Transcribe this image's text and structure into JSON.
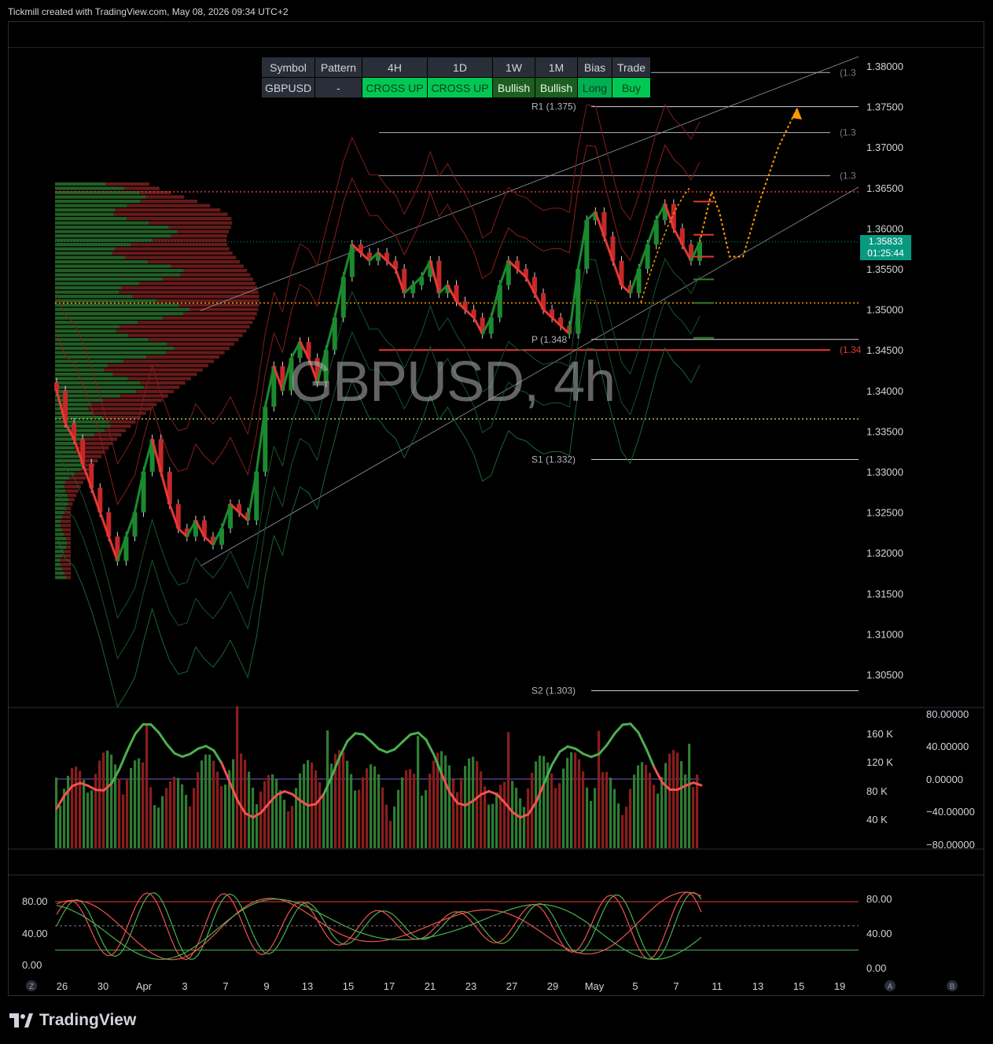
{
  "header": {
    "text": "Tickmill created with TradingView.com, May 08, 2026 09:34 UTC+2"
  },
  "brand": {
    "name": "TradingView"
  },
  "watermark": {
    "symbol": "GBPUSD, 4h"
  },
  "table": {
    "headers": [
      "Symbol",
      "Pattern",
      "4H",
      "1D",
      "1W",
      "1M",
      "Bias",
      "Trade"
    ],
    "row": [
      "GBPUSD",
      "-",
      "CROSS UP",
      "CROSS UP",
      "Bullish",
      "Bullish",
      "Long",
      "Buy"
    ]
  },
  "price_tag": {
    "price": "1.35833",
    "countdown": "01:25:44"
  },
  "colors": {
    "up": "#2e7d32",
    "down": "#e53935",
    "accent_orange": "#ff9800",
    "price_tag": "#089981"
  },
  "chart_data": [
    {
      "type": "line",
      "name": "price",
      "ylabel": "",
      "y_ticks": [
        "1.38000",
        "1.37500",
        "1.37000",
        "1.36500",
        "1.36000",
        "1.35500",
        "1.35000",
        "1.34500",
        "1.34000",
        "1.33500",
        "1.33000",
        "1.32500",
        "1.32000",
        "1.31500",
        "1.31000",
        "1.30500"
      ],
      "ylim": [
        1.3015,
        1.3825
      ],
      "x_ticks": [
        "26",
        "30",
        "Apr",
        "3",
        "7",
        "9",
        "13",
        "15",
        "17",
        "21",
        "23",
        "27",
        "29",
        "May",
        "5",
        "7",
        "11",
        "13",
        "15",
        "19"
      ],
      "levels": [
        {
          "label": "R1 (1.375)",
          "value": 1.375
        },
        {
          "label": "P (1.348",
          "value": 1.3463
        },
        {
          "label": "S1 (1.332)",
          "value": 1.3315
        },
        {
          "label": "S2 (1.303)",
          "value": 1.303
        },
        {
          "label": "(1.3",
          "value": 1.3792
        },
        {
          "label": "(1.3",
          "value": 1.3718
        },
        {
          "label": "(1.3",
          "value": 1.3665
        },
        {
          "label": "(1.34",
          "value": 1.345
        }
      ],
      "horizontal_refs": [
        1.3645,
        1.3508,
        1.3365
      ],
      "close_path": [
        1.34,
        1.336,
        1.334,
        1.331,
        1.328,
        1.325,
        1.322,
        1.319,
        1.322,
        1.325,
        1.33,
        1.334,
        1.33,
        1.326,
        1.323,
        1.322,
        1.324,
        1.322,
        1.321,
        1.323,
        1.326,
        1.325,
        1.324,
        1.33,
        1.338,
        1.343,
        1.34,
        1.344,
        1.346,
        1.344,
        1.341,
        1.345,
        1.349,
        1.354,
        1.358,
        1.357,
        1.356,
        1.357,
        1.356,
        1.355,
        1.352,
        1.353,
        1.354,
        1.356,
        1.352,
        1.353,
        1.351,
        1.35,
        1.349,
        1.347,
        1.349,
        1.353,
        1.356,
        1.355,
        1.354,
        1.352,
        1.35,
        1.349,
        1.348,
        1.347,
        1.355,
        1.361,
        1.362,
        1.359,
        1.356,
        1.353,
        1.352,
        1.355,
        1.358,
        1.361,
        1.363,
        1.36,
        1.358,
        1.356,
        1.3583
      ],
      "projection": [
        1.3583,
        1.3645,
        1.362,
        1.3565,
        1.3565,
        1.363,
        1.37,
        1.375
      ],
      "last_price": 1.35833
    },
    {
      "type": "bar",
      "name": "volume",
      "y_ticks_left": [
        "160 K",
        "120 K",
        "80 K",
        "40 K"
      ],
      "y_ticks_right": [
        "80.00000",
        "40.00000",
        "0.00000",
        "−40.00000",
        "−80.00000"
      ],
      "ylim": [
        0,
        180000
      ]
    },
    {
      "type": "line",
      "name": "oscillator",
      "y_ticks_left": [
        "80.00",
        "40.00",
        "0.00"
      ],
      "y_ticks_right": [
        "80.00",
        "40.00",
        "0.00"
      ],
      "ylim": [
        0,
        100
      ],
      "levels": [
        80,
        50,
        20
      ]
    }
  ],
  "scale_buttons": [
    "Z",
    "A",
    "B"
  ]
}
